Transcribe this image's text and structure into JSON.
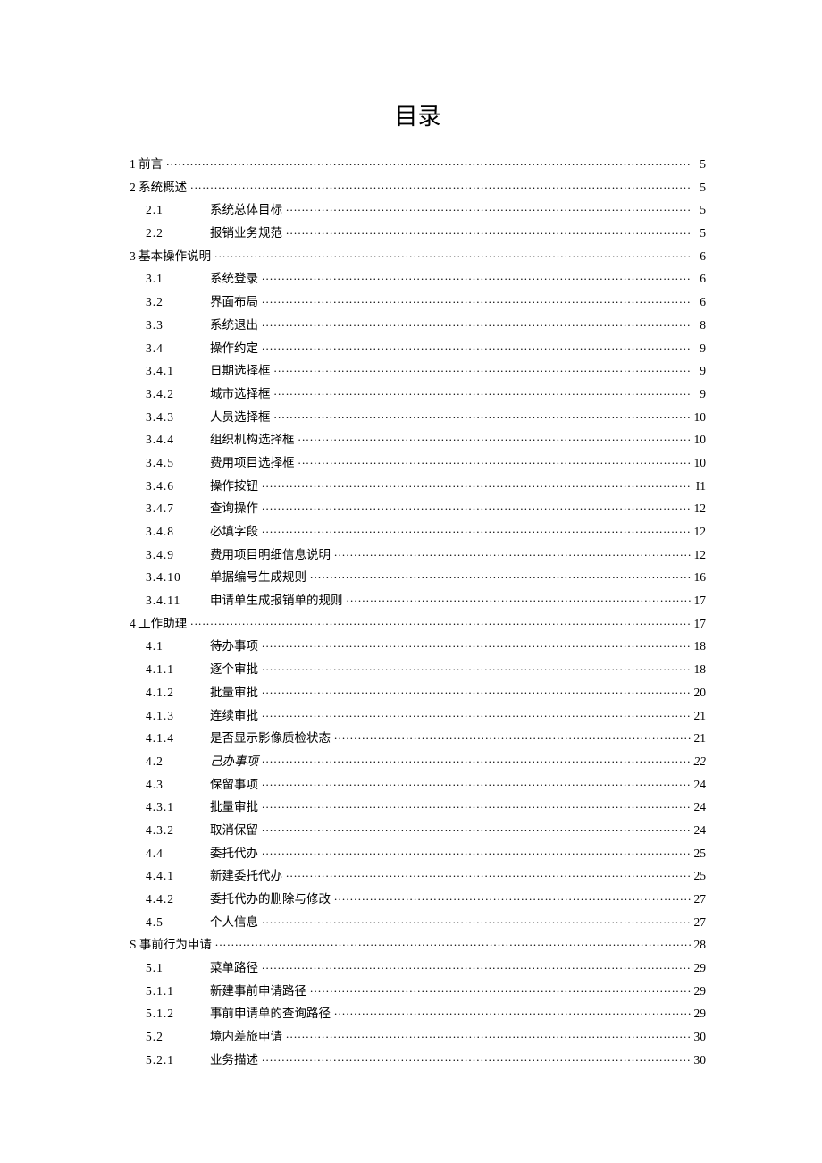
{
  "title": "目录",
  "toc": [
    {
      "num": "1",
      "label": "前言",
      "page": "5",
      "level": 0
    },
    {
      "num": "2",
      "label": "系统概述",
      "page": "5",
      "level": 0
    },
    {
      "num": "2.1",
      "label": "系统总体目标",
      "page": "5",
      "level": 1
    },
    {
      "num": "2.2",
      "label": "报销业务规范",
      "page": "5",
      "level": 1
    },
    {
      "num": "3",
      "label": "基本操作说明",
      "page": "6",
      "level": 0
    },
    {
      "num": "3.1",
      "label": "系统登录",
      "page": "6",
      "level": 1
    },
    {
      "num": "3.2",
      "label": "界面布局",
      "page": "6",
      "level": 1
    },
    {
      "num": "3.3",
      "label": "系统退出",
      "page": "8",
      "level": 1
    },
    {
      "num": "3.4",
      "label": "操作约定",
      "page": "9",
      "level": 1
    },
    {
      "num": "3.4.1",
      "label": "日期选择框",
      "page": "9",
      "level": 2
    },
    {
      "num": "3.4.2",
      "label": "城市选择框",
      "page": "9",
      "level": 2
    },
    {
      "num": "3.4.3",
      "label": "人员选择框",
      "page": "10",
      "level": 2
    },
    {
      "num": "3.4.4",
      "label": "组织机构选择框",
      "page": "10",
      "level": 2
    },
    {
      "num": "3.4.5",
      "label": "费用项目选择框",
      "page": "10",
      "level": 2
    },
    {
      "num": "3.4.6",
      "label": "操作按钮",
      "page": "I1",
      "level": 2
    },
    {
      "num": "3.4.7",
      "label": "查询操作",
      "page": "12",
      "level": 2
    },
    {
      "num": "3.4.8",
      "label": "必填字段",
      "page": "12",
      "level": 2
    },
    {
      "num": "3.4.9",
      "label": "费用项目明细信息说明",
      "page": "12",
      "level": 2
    },
    {
      "num": "3.4.10",
      "label": "单据编号生成规则",
      "page": "16",
      "level": 2
    },
    {
      "num": "3.4.11",
      "label": "申请单生成报销单的规则",
      "page": "17",
      "level": 2
    },
    {
      "num": "4",
      "label": "工作助理",
      "page": "17",
      "level": 0
    },
    {
      "num": "4.1",
      "label": "待办事项",
      "page": "18",
      "level": 1
    },
    {
      "num": "4.1.1",
      "label": "逐个审批",
      "page": "18",
      "level": 2
    },
    {
      "num": "4.1.2",
      "label": "批量审批",
      "page": "20",
      "level": 2
    },
    {
      "num": "4.1.3",
      "label": "连续审批",
      "page": "21",
      "level": 2
    },
    {
      "num": "4.1.4",
      "label": "是否显示影像质检状态",
      "page": "21",
      "level": 2
    },
    {
      "num": "4.2",
      "label": "己办事项",
      "page": "22",
      "level": 1,
      "italic": true
    },
    {
      "num": "4.3",
      "label": "保留事项",
      "page": "24",
      "level": 1
    },
    {
      "num": "4.3.1",
      "label": "批量审批",
      "page": "24",
      "level": 2
    },
    {
      "num": "4.3.2",
      "label": "取消保留",
      "page": "24",
      "level": 2
    },
    {
      "num": "4.4",
      "label": "委托代办",
      "page": "25",
      "level": 1
    },
    {
      "num": "4.4.1",
      "label": "新建委托代办",
      "page": "25",
      "level": 2
    },
    {
      "num": "4.4.2",
      "label": "委托代办的删除与修改",
      "page": "27",
      "level": 2
    },
    {
      "num": "4.5",
      "label": "个人信息",
      "page": "27",
      "level": 1
    },
    {
      "num": "S",
      "label": "事前行为申请",
      "page": "28",
      "level": 0
    },
    {
      "num": "5.1",
      "label": "菜单路径",
      "page": "29",
      "level": 1
    },
    {
      "num": "5.1.1",
      "label": "新建事前申请路径",
      "page": "29",
      "level": 2
    },
    {
      "num": "5.1.2",
      "label": "事前申请单的查询路径",
      "page": "29",
      "level": 2
    },
    {
      "num": "5.2",
      "label": "境内差旅申请",
      "page": "30",
      "level": 1
    },
    {
      "num": "5.2.1",
      "label": "业务描述",
      "page": "30",
      "level": 2
    }
  ]
}
